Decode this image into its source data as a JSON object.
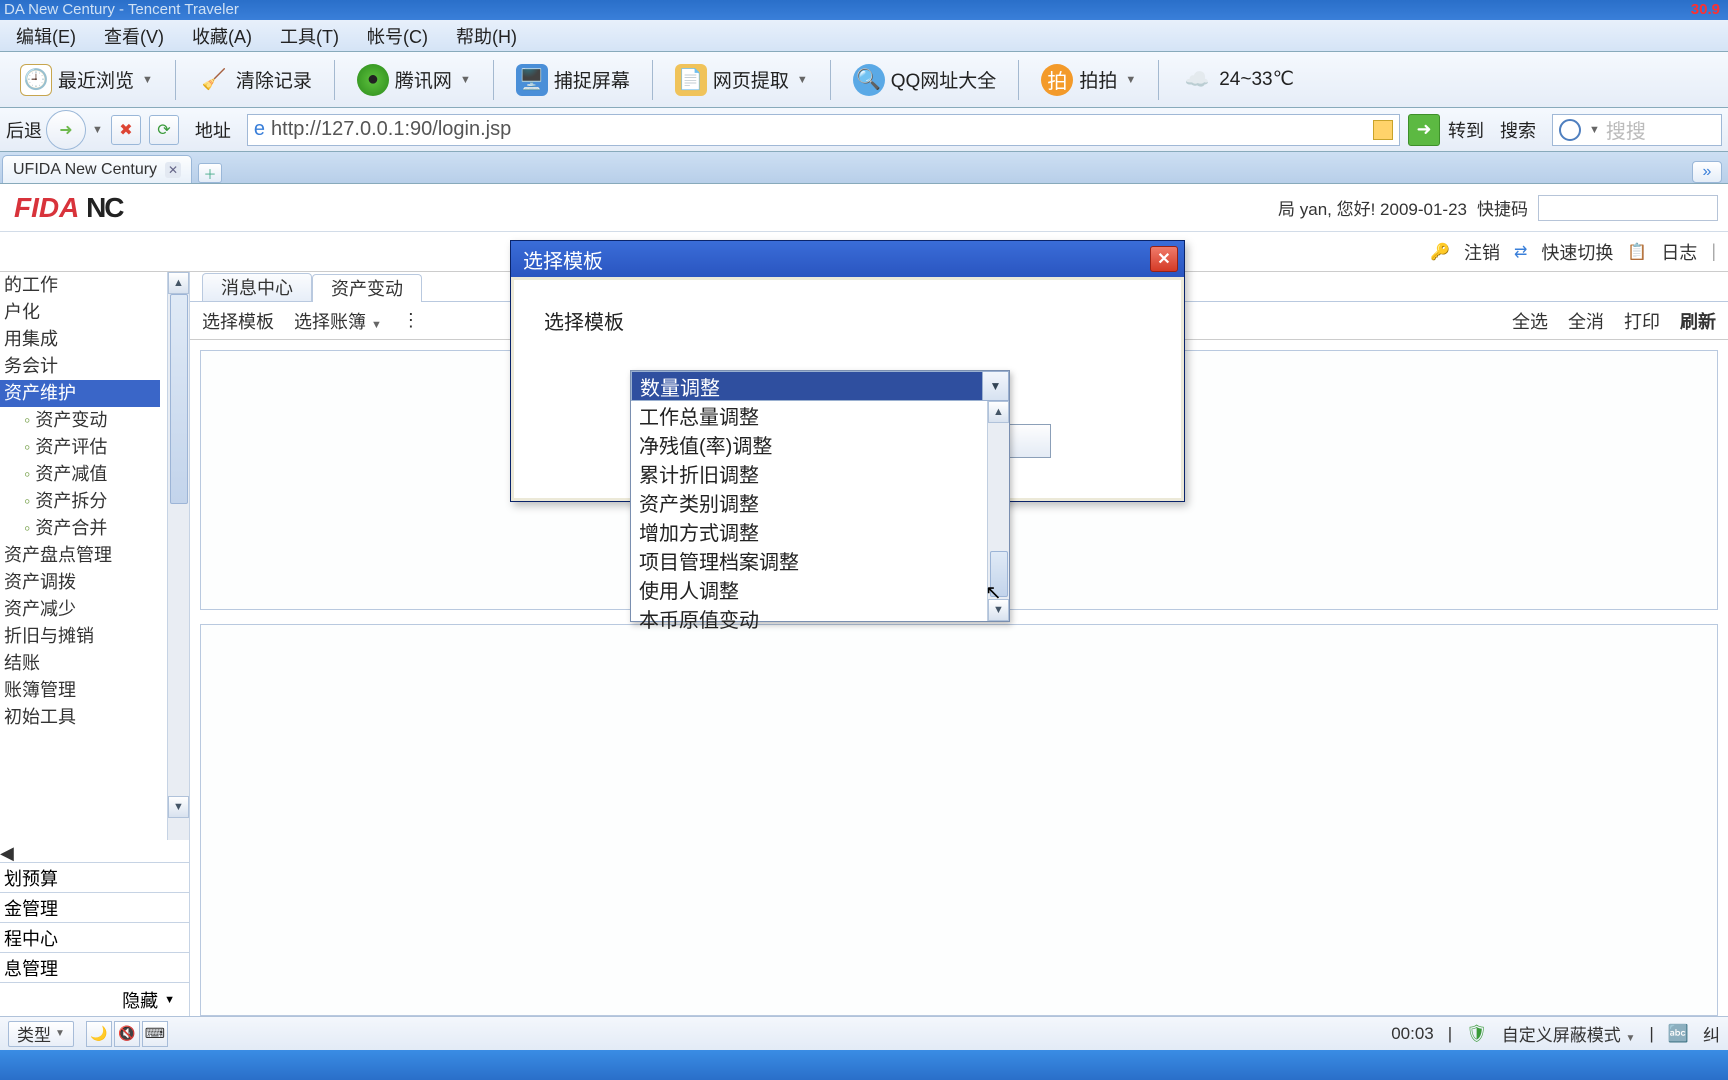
{
  "titlebar": {
    "text": "DA New Century - Tencent Traveler",
    "right": "30.9"
  },
  "menu": {
    "edit": "编辑(E)",
    "view": "查看(V)",
    "fav": "收藏(A)",
    "tools": "工具(T)",
    "account": "帐号(C)",
    "help": "帮助(H)"
  },
  "toolbar": {
    "recent": "最近浏览",
    "clear": "清除记录",
    "tencent": "腾讯网",
    "capture": "捕捉屏幕",
    "extract": "网页提取",
    "qqnav": "QQ网址大全",
    "paipai": "拍拍",
    "weather": "24~33℃"
  },
  "addr": {
    "back": "后退",
    "label": "地址",
    "url": "http://127.0.0.1:90/login.jsp",
    "go": "转到",
    "search_label": "搜索",
    "search_ph": "搜搜"
  },
  "tabs": {
    "t1": "UFIDA New Century"
  },
  "pagehdr": {
    "logo1": "FIDA ",
    "logo2": "NC",
    "greet": "局 yan, 您好! 2009-01-23",
    "qkm": "快捷码"
  },
  "pagehdr2": {
    "logout": "注销",
    "switch": "快速切换",
    "log": "日志"
  },
  "sidebar": {
    "items": [
      "的工作",
      "户化",
      "用集成",
      "务会计",
      "资产维护",
      "资产变动",
      "资产评估",
      "资产减值",
      "资产拆分",
      "资产合并",
      "资产盘点管理",
      "资产调拨",
      "资产减少",
      "折旧与摊销",
      "结账",
      "账簿管理",
      "初始工具"
    ],
    "foot1": "划预算",
    "foot_items": [
      "金管理",
      "程中心",
      "息管理"
    ],
    "hide": "隐藏"
  },
  "content": {
    "tabs": [
      "消息中心",
      "资产变动"
    ],
    "toolbar": {
      "tpl": "选择模板",
      "book": "选择账簿"
    },
    "rtool": {
      "all": "全选",
      "none": "全消",
      "print": "打印",
      "refresh": "刷新"
    }
  },
  "dialog": {
    "title": "选择模板",
    "label": "选择模板"
  },
  "dropdown": {
    "selected": "数量调整",
    "options": [
      "工作总量调整",
      "净残值(率)调整",
      "累计折旧调整",
      "资产类别调整",
      "增加方式调整",
      "项目管理档案调整",
      "使用人调整",
      "本币原值变动"
    ]
  },
  "status": {
    "type": "类型",
    "time": "00:03",
    "mode": "自定义屏蔽模式",
    "enc": "纠"
  }
}
